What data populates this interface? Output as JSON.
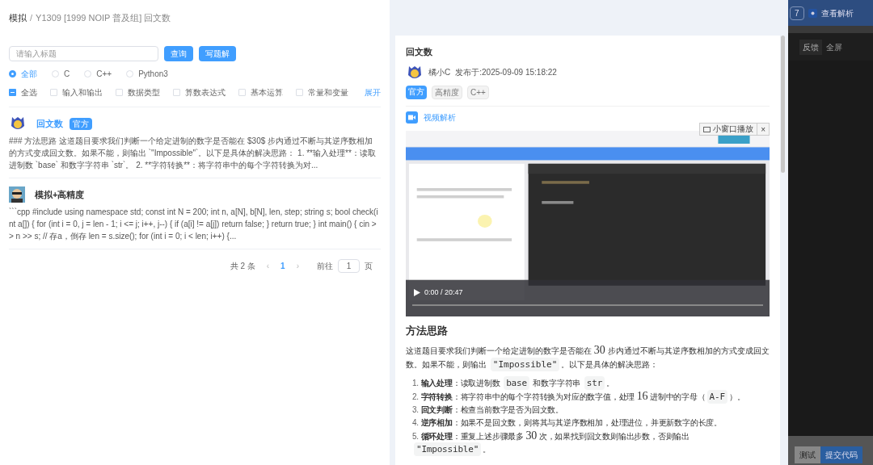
{
  "breadcrumb": {
    "parent": "模拟",
    "separator": "/",
    "current": "Y1309 [1999 NOIP 普及组] 回文数"
  },
  "search": {
    "placeholder": "请输入标题",
    "buttons": [
      "查询",
      "写题解"
    ]
  },
  "languages": [
    {
      "label": "全部",
      "selected": true
    },
    {
      "label": "C",
      "selected": false
    },
    {
      "label": "C++",
      "selected": false
    },
    {
      "label": "Python3",
      "selected": false
    }
  ],
  "tags_filter": {
    "items": [
      {
        "label": "全选",
        "checked": true
      },
      {
        "label": "输入和输出",
        "checked": false
      },
      {
        "label": "数据类型",
        "checked": false
      },
      {
        "label": "算数表达式",
        "checked": false
      },
      {
        "label": "基本运算",
        "checked": false
      },
      {
        "label": "常量和变量",
        "checked": false
      }
    ],
    "expand": "展开"
  },
  "solutions": [
    {
      "title": "回文数",
      "badge": "官方",
      "selected": true,
      "excerpt": "### 方法思路 这道题目要求我们判断一个给定进制的数字是否能在 $30$ 步内通过不断与其逆序数相加的方式变成回文数。如果不能，则输出 `\"Impossible\"`。以下是具体的解决思路： 1. **输入处理**：读取进制数 `base` 和数字字符串 `str`。 2. **字符转换**：将字符串中的每个字符转换为对..."
    },
    {
      "title": "模拟+高精度",
      "selected": false,
      "excerpt": "```cpp #include using namespace std; const int N = 200; int n, a[N], b[N], len, step; string s; bool check(int a[]) { for (int i = 0, j = len - 1; i <= j; i++, j--) { if (a[i] != a[j]) return false; } return true; } int main() { cin >> n >> s; // 存a，倒存 len = s.size(); for (int i = 0; i < len; i++) {..."
    }
  ],
  "pagination": {
    "total": "共 2 条",
    "prev": "‹",
    "pages": [
      {
        "label": "1",
        "selected": true
      }
    ],
    "next": "›",
    "goto": "前往",
    "page_input": "1",
    "page_unit": "页"
  },
  "detail": {
    "title": "回文数",
    "author": "橘小C",
    "published": "发布于:2025-09-09 15:18:22",
    "tags": [
      {
        "label": "官方",
        "kind": "official"
      },
      {
        "label": "高精度",
        "kind": "plain"
      },
      {
        "label": "C++",
        "kind": "plain"
      }
    ],
    "video_link": "视频解析",
    "video": {
      "mini_player": "小窗口播放",
      "close": "×",
      "time": "0:00 / 20:47"
    },
    "section_title": "方法思路",
    "intro": [
      "这道题目要求我们判断一个给定进制的数字是否能在 ",
      {
        "math": "30"
      },
      " 步内通过不断与其逆序数相加的方式变成回文数。如果不能，则输出 ",
      {
        "code": "\"Impossible\""
      },
      "。以下是具体的解决思路："
    ],
    "steps": [
      {
        "num": "1.",
        "title": "输入处理",
        "parts": [
          "：读取进制数 ",
          {
            "code": "base"
          },
          " 和数字字符串 ",
          {
            "code": "str"
          },
          "。"
        ]
      },
      {
        "num": "2.",
        "title": "字符转换",
        "parts": [
          "：将字符串中的每个字符转换为对应的数字值，处理 ",
          {
            "math": "16"
          },
          " 进制中的字母（",
          {
            "code": "A-F"
          },
          "）。"
        ]
      },
      {
        "num": "3.",
        "title": "回文判断",
        "parts": [
          "：检查当前数字是否为回文数。"
        ]
      },
      {
        "num": "4.",
        "title": "逆序相加",
        "parts": [
          "：如果不是回文数，则将其与其逆序数相加，处理进位，并更新数字的长度。"
        ]
      },
      {
        "num": "5.",
        "title": "循环处理",
        "parts": [
          "：重复上述步骤最多 ",
          {
            "math": "30"
          },
          " 次，如果找到回文数则输出步数，否则输出 ",
          {
            "code": "\"Impossible\""
          },
          "。"
        ]
      }
    ]
  },
  "background": {
    "page_button": "7",
    "analysis": "查看解析",
    "feedback": "反馈",
    "fullscreen": "全屏",
    "test": "测试",
    "submit": "提交代码"
  }
}
